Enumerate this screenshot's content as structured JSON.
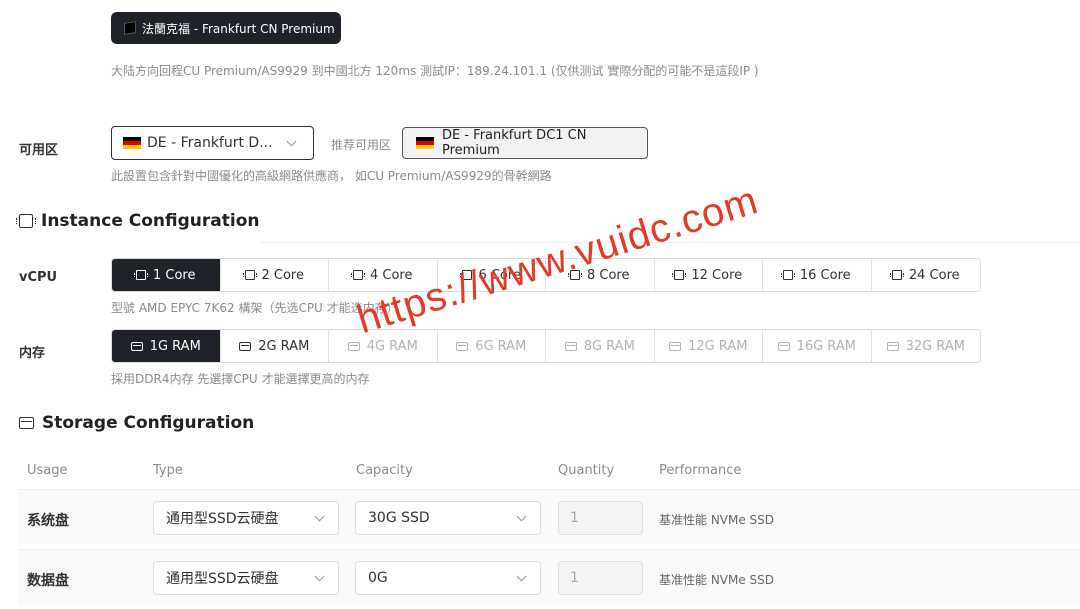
{
  "region": {
    "button_label": "法蘭克福 - Frankfurt CN Premium",
    "hint": "大陆方向回程CU Premium/AS9929 到中國北方 120ms 測試IP：189.24.101.1 (仅供测试 實際分配的可能不是這段IP )"
  },
  "zone": {
    "label": "可用区",
    "selected": "DE - Frankfurt D...",
    "recommended_label": "推荐可用区",
    "recommended_value": "DE - Frankfurt DC1 CN Premium",
    "hint": "此設置包含針對中國優化的高級網路供應商， 如CU Premium/AS9929的骨幹網路",
    "flag_colors": [
      "#000000",
      "#dd0000",
      "#ffce00"
    ]
  },
  "instance": {
    "title": "Instance Configuration",
    "vcpu": {
      "label": "vCPU",
      "options": [
        "1 Core",
        "2 Core",
        "4 Core",
        "6 Core",
        "8 Core",
        "12 Core",
        "16 Core",
        "24 Core"
      ],
      "selected": "1 Core",
      "hint": "型號 AMD EPYC 7K62 構架（先选CPU 才能选内存）"
    },
    "memory": {
      "label": "内存",
      "options": [
        "1G RAM",
        "2G RAM",
        "4G RAM",
        "6G RAM",
        "8G RAM",
        "12G RAM",
        "16G RAM",
        "32G RAM"
      ],
      "selected": "1G RAM",
      "enabled_count": 2,
      "hint": "採用DDR4内存 先選擇CPU 才能選擇更高的内存"
    }
  },
  "storage": {
    "title": "Storage Configuration",
    "headers": [
      "Usage",
      "Type",
      "Capacity",
      "Quantity",
      "Performance"
    ],
    "rows": [
      {
        "usage": "系统盘",
        "type": "通用型SSD云硬盘",
        "capacity": "30G SSD",
        "quantity": "1",
        "performance": "基准性能 NVMe SSD"
      },
      {
        "usage": "数据盘",
        "type": "通用型SSD云硬盘",
        "capacity": "0G",
        "quantity": "1",
        "performance": "基准性能 NVMe SSD"
      }
    ]
  },
  "watermark": "https://www.vuidc.com",
  "colors": {
    "accent_dark": "#1f2329",
    "watermark": "#e33b2a"
  }
}
